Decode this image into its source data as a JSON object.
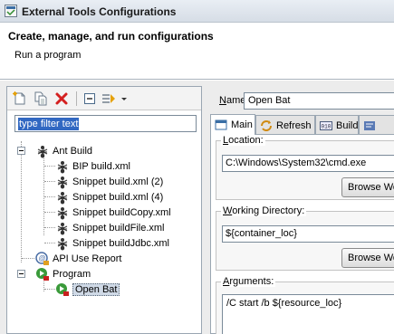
{
  "window": {
    "title": "External Tools Configurations"
  },
  "header": {
    "title": "Create, manage, and run configurations",
    "subtitle": "Run a program"
  },
  "toolbar": {
    "buttons": [
      "new-configuration-icon",
      "duplicate-icon",
      "delete-icon",
      "collapse-all-icon",
      "filter-icon",
      "view-menu-icon"
    ]
  },
  "filter": {
    "value": "type filter text"
  },
  "tree": {
    "ant_build": {
      "label": "Ant Build",
      "children": [
        "BIP build.xml",
        "Snippet build.xml (2)",
        "Snippet build.xml (4)",
        "Snippet buildCopy.xml",
        "Snippet buildFile.xml",
        "Snippet buildJdbc.xml"
      ]
    },
    "api_use_report": {
      "label": "API Use Report"
    },
    "program": {
      "label": "Program",
      "children": [
        "Open Bat"
      ]
    }
  },
  "config": {
    "name_label": "Name:",
    "name_value": "Open Bat",
    "tabs": [
      {
        "label": "Main",
        "icon": "main-tab-icon",
        "active": true
      },
      {
        "label": "Refresh",
        "icon": "refresh-icon"
      },
      {
        "label": "Build",
        "icon": "build-icon"
      },
      {
        "label": "",
        "icon": "environment-icon"
      }
    ],
    "location": {
      "label": "Location:",
      "value": "C:\\Windows\\System32\\cmd.exe",
      "browse": "Browse Wo"
    },
    "working_dir": {
      "label": "Working Directory:",
      "value": "${container_loc}",
      "browse": "Browse Wo"
    },
    "arguments": {
      "label": "Arguments:",
      "value": "/C start /b ${resource_loc}"
    }
  }
}
